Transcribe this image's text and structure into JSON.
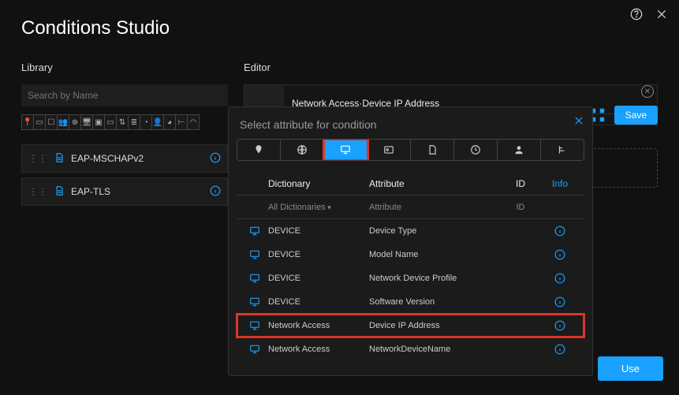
{
  "header": {
    "title": "Conditions Studio"
  },
  "library": {
    "label": "Library",
    "search_placeholder": "Search by Name",
    "items": [
      {
        "name": "EAP-MSCHAPv2"
      },
      {
        "name": "EAP-TLS"
      }
    ]
  },
  "editor": {
    "label": "Editor",
    "path": "Network Access·Device IP Address",
    "save": "Save",
    "use": "Use"
  },
  "modal": {
    "title": "Select attribute for condition",
    "columns": {
      "dictionary": "Dictionary",
      "attribute": "Attribute",
      "id": "ID",
      "info": "Info"
    },
    "filters": {
      "dictionary": "All Dictionaries",
      "attribute": "Attribute",
      "id": "ID"
    },
    "rows": [
      {
        "dict": "DEVICE",
        "attr": "Device Type",
        "selected": false
      },
      {
        "dict": "DEVICE",
        "attr": "Model Name",
        "selected": false
      },
      {
        "dict": "DEVICE",
        "attr": "Network Device Profile",
        "selected": false
      },
      {
        "dict": "DEVICE",
        "attr": "Software Version",
        "selected": false
      },
      {
        "dict": "Network Access",
        "attr": "Device IP Address",
        "selected": true
      },
      {
        "dict": "Network Access",
        "attr": "NetworkDeviceName",
        "selected": false
      }
    ]
  }
}
